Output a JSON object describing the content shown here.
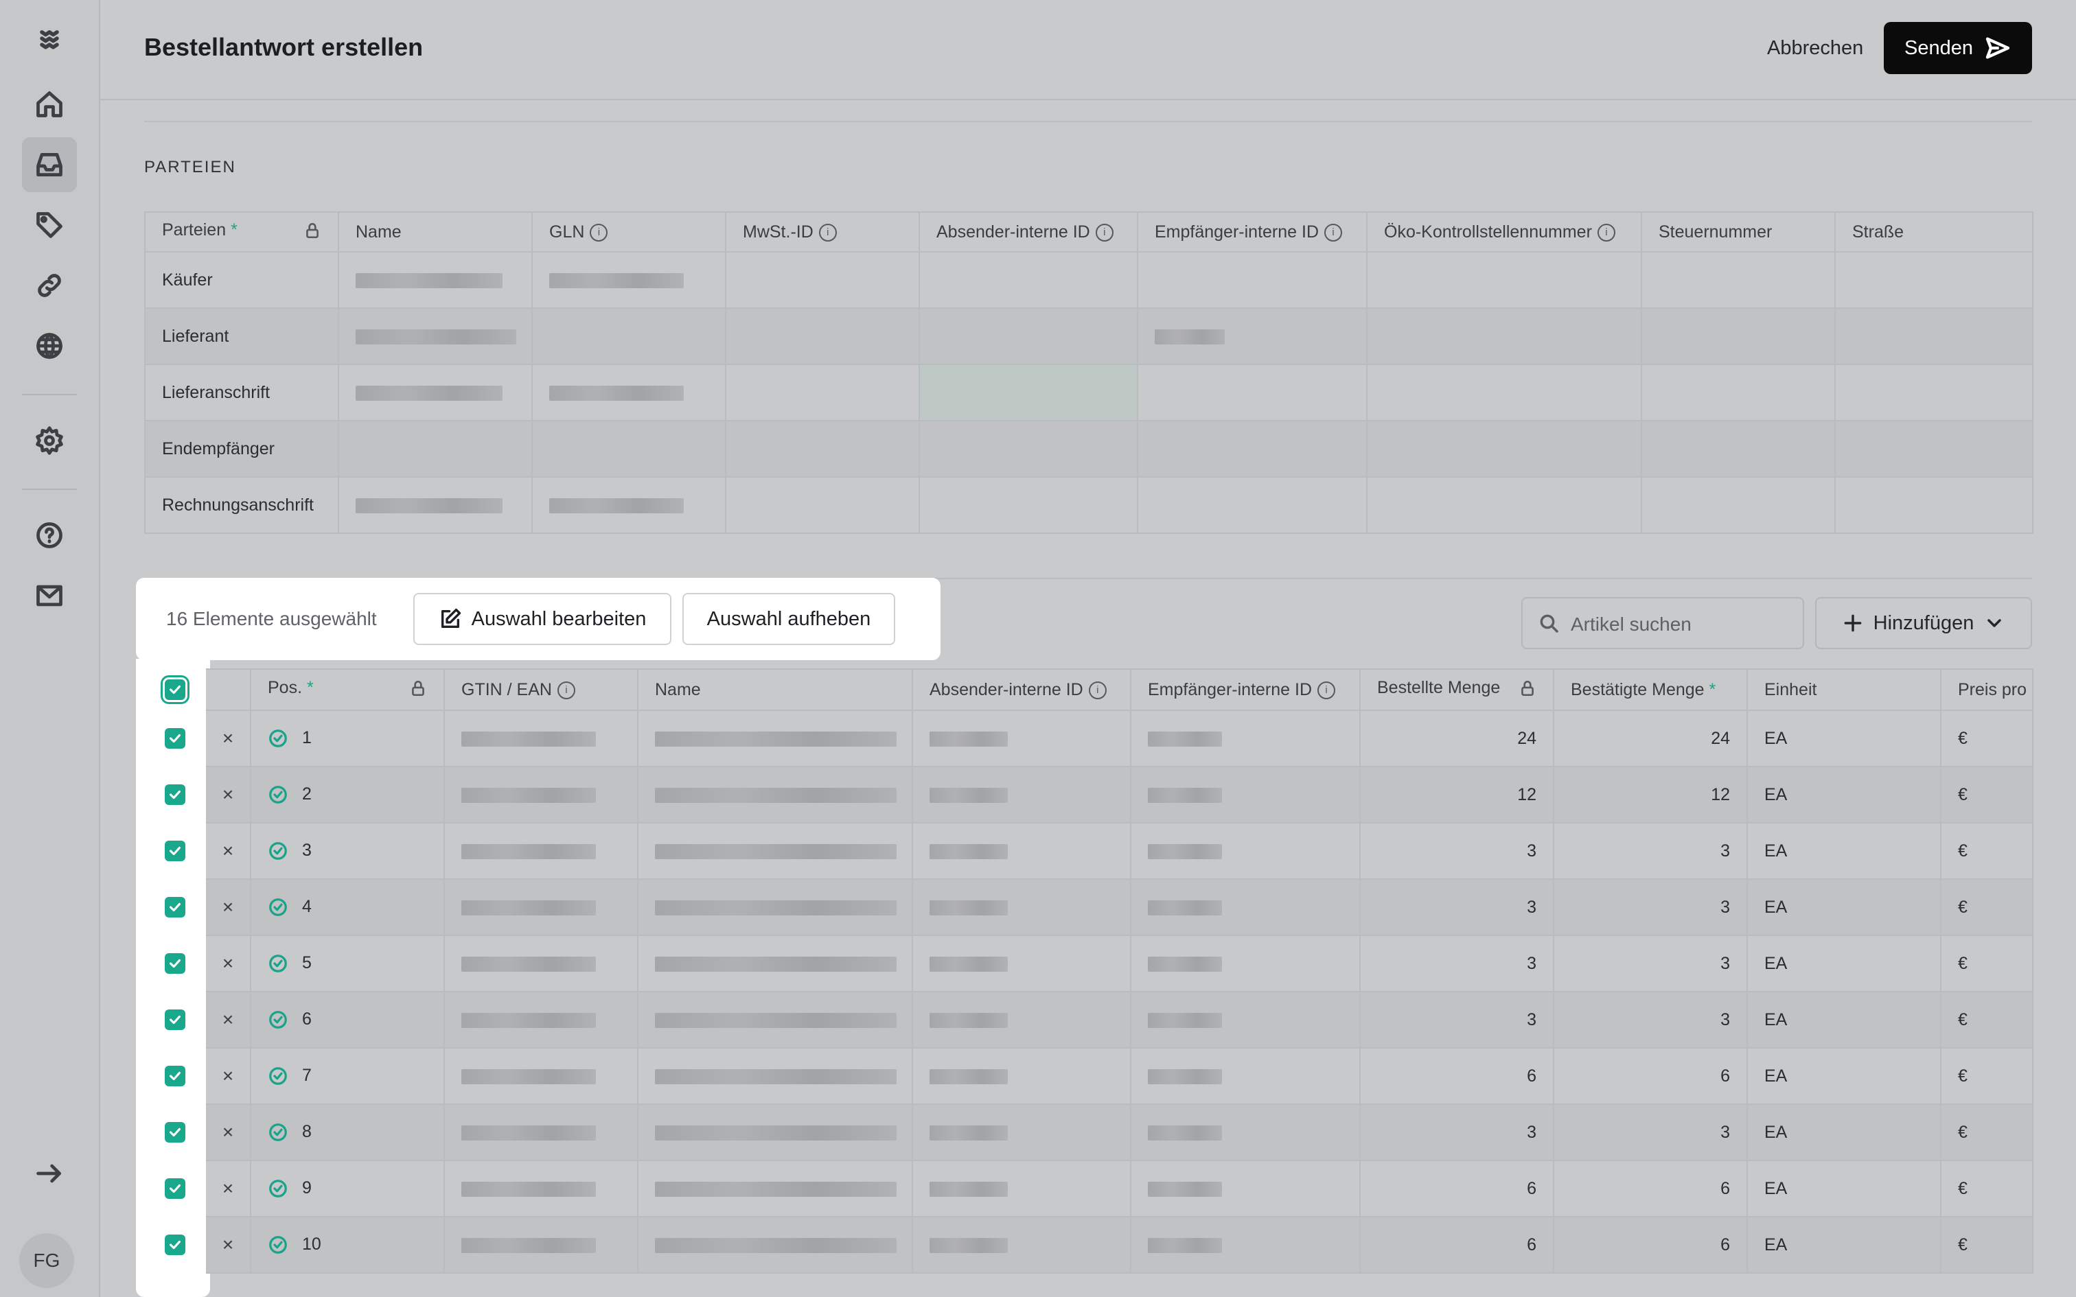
{
  "header": {
    "title": "Bestellantwort erstellen",
    "cancel_label": "Abbrechen",
    "send_label": "Senden"
  },
  "sidebar": {
    "avatar_initials": "FG"
  },
  "parties": {
    "section_label": "PARTEIEN",
    "columns": [
      "Parteien",
      "Name",
      "GLN",
      "MwSt.-ID",
      "Absender-interne ID",
      "Empfänger-interne ID",
      "Öko-Kontrollstellennummer",
      "Steuernummer",
      "Straße"
    ],
    "rows": [
      "Käufer",
      "Lieferant",
      "Lieferanschrift",
      "Endempfänger",
      "Rechnungsanschrift"
    ]
  },
  "selection": {
    "count_text": "16 Elemente ausgewählt",
    "edit_label": "Auswahl bearbeiten",
    "clear_label": "Auswahl aufheben"
  },
  "search": {
    "placeholder": "Artikel suchen"
  },
  "add_label": "Hinzufügen",
  "items": {
    "columns": [
      "Pos.",
      "GTIN / EAN",
      "Name",
      "Absender-interne ID",
      "Empfänger-interne ID",
      "Bestellte Menge",
      "Bestätigte Menge",
      "Einheit",
      "Preis pro"
    ],
    "rows": [
      {
        "pos": "1",
        "ordered": "24",
        "confirmed": "24",
        "unit": "EA",
        "price": "€"
      },
      {
        "pos": "2",
        "ordered": "12",
        "confirmed": "12",
        "unit": "EA",
        "price": "€"
      },
      {
        "pos": "3",
        "ordered": "3",
        "confirmed": "3",
        "unit": "EA",
        "price": "€"
      },
      {
        "pos": "4",
        "ordered": "3",
        "confirmed": "3",
        "unit": "EA",
        "price": "€"
      },
      {
        "pos": "5",
        "ordered": "3",
        "confirmed": "3",
        "unit": "EA",
        "price": "€"
      },
      {
        "pos": "6",
        "ordered": "3",
        "confirmed": "3",
        "unit": "EA",
        "price": "€"
      },
      {
        "pos": "7",
        "ordered": "6",
        "confirmed": "6",
        "unit": "EA",
        "price": "€"
      },
      {
        "pos": "8",
        "ordered": "3",
        "confirmed": "3",
        "unit": "EA",
        "price": "€"
      },
      {
        "pos": "9",
        "ordered": "6",
        "confirmed": "6",
        "unit": "EA",
        "price": "€"
      },
      {
        "pos": "10",
        "ordered": "6",
        "confirmed": "6",
        "unit": "EA",
        "price": "€"
      }
    ]
  }
}
